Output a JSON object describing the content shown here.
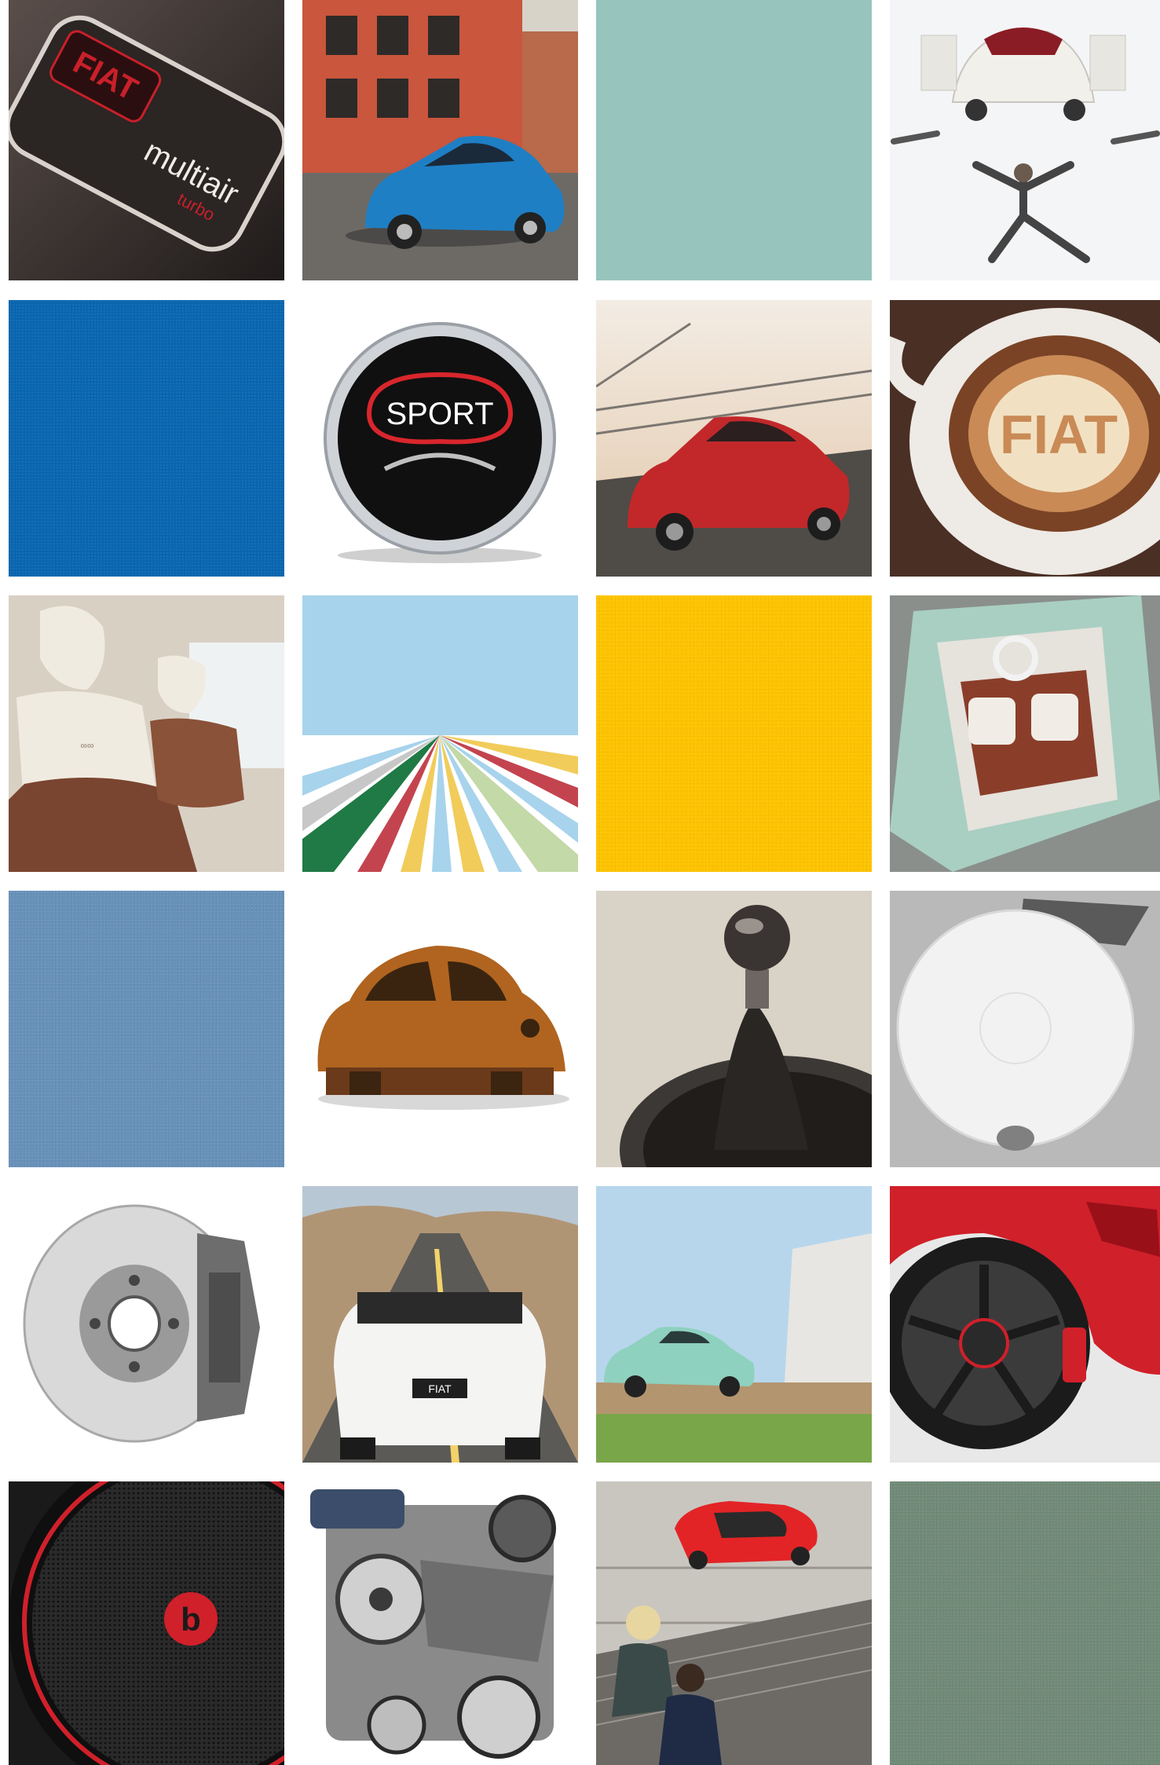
{
  "tiles": {
    "r1c1": {
      "logo_text": "FIAT",
      "caption_main": "multiair",
      "caption_sub": "turbo",
      "badge_bg": "#3b3230",
      "accent": "#c8202a"
    },
    "r1c2": {
      "car_color": "#1f7fc4",
      "building_color": "#c9563d"
    },
    "r1c3": {
      "color": "#97c5bd"
    },
    "r1c4": {
      "car_color": "#f2f0ea",
      "roof_color": "#8a1c25"
    },
    "r2c1": {
      "color": "#0a66b0"
    },
    "r2c2": {
      "button_text": "SPORT",
      "accent": "#d8262c"
    },
    "r2c3": {
      "car_color": "#c2282a"
    },
    "r2c4": {
      "latte_text": "FIAT",
      "foam_color": "#f1e1c2"
    },
    "r3c1": {
      "seat_color": "#f0ebe0",
      "leather_color": "#7a4530"
    },
    "r3c2": {
      "sky_color": "#a7d3ec",
      "stripe_colors": [
        "#1f7a45",
        "#c3444f",
        "#f1cc5a",
        "#a7d3ec",
        "#ffffff"
      ]
    },
    "r3c3": {
      "color": "#fdc300"
    },
    "r3c4": {
      "car_color": "#a9cfc2",
      "interior_color": "#8a3e2a"
    },
    "r4c1": {
      "color": "#6891b9"
    },
    "r4c2": {
      "body_color": "#b0641f"
    },
    "r4c3": {
      "knob_color": "#3a3532",
      "boot_color": "#2a2624"
    },
    "r4c4": {
      "bg_color": "#b9b9b9",
      "airbag_color": "#f2f2f2"
    },
    "r5c1": {
      "disc_color": "#d9d9d9",
      "caliper_color": "#6d6d6d"
    },
    "r5c2": {
      "road_color": "#5b5a56",
      "car_color": "#f4f4f2",
      "plate_text": "FIAT"
    },
    "r5c3": {
      "car_color": "#8ed1bf",
      "sky_color": "#b7d6ec"
    },
    "r5c4": {
      "car_color": "#d0202a",
      "wheel_color": "#3b3b3b"
    },
    "r6c1": {
      "speaker_color": "#2a2a2a",
      "logo_color": "#d0202a",
      "logo_text": "b"
    },
    "r6c2": {
      "engine_color": "#8a8a8a"
    },
    "r6c3": {
      "car_color": "#e32426",
      "ground_color": "#c9c6c0"
    },
    "r6c4": {
      "color": "#718a78"
    }
  }
}
